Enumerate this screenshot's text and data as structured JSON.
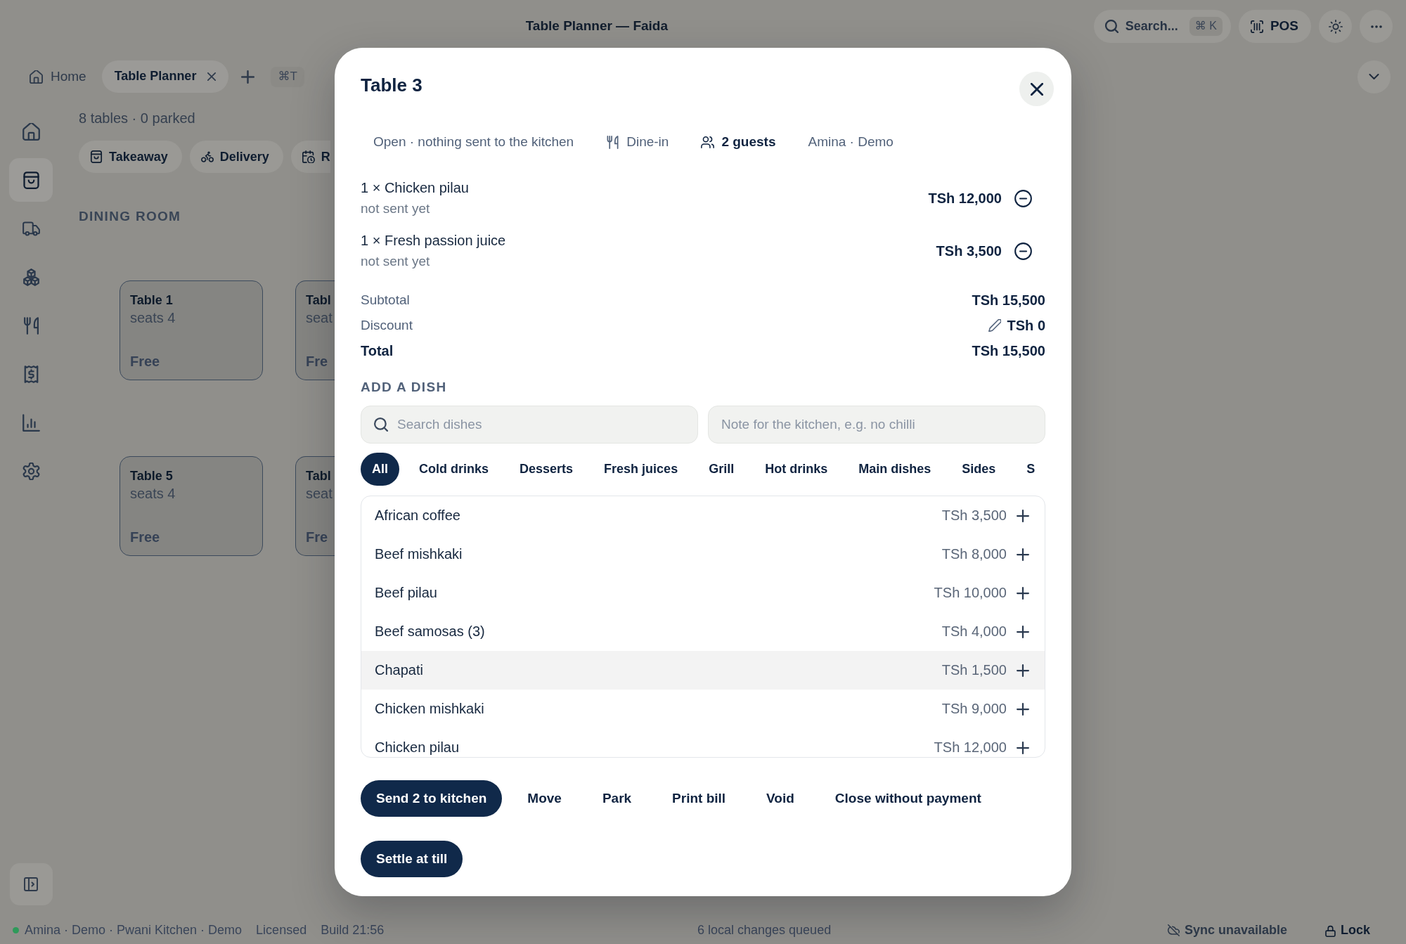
{
  "window": {
    "title": "Table Planner — Faida"
  },
  "toolbar": {
    "search": {
      "label": "Search...",
      "shortcut": "⌘ K"
    },
    "pos": {
      "label": "POS"
    }
  },
  "tabs": [
    {
      "kind": "home",
      "label": "Home",
      "selected": false,
      "closable": false
    },
    {
      "kind": "page",
      "label": "Table Planner",
      "selected": true,
      "closable": true
    }
  ],
  "new_tab": {
    "shortcut": "⌘T"
  },
  "sidebar": {
    "items": [
      {
        "selected": false
      },
      {
        "selected": true
      },
      {
        "selected": false
      },
      {
        "selected": false
      },
      {
        "selected": false
      },
      {
        "selected": false
      },
      {
        "selected": false
      },
      {
        "selected": false
      }
    ]
  },
  "floor": {
    "summary": "8 tables · 0 parked",
    "quick_actions": [
      {
        "label": "Takeaway"
      },
      {
        "label": "Delivery"
      },
      {
        "label": "R"
      }
    ],
    "section": "DINING ROOM",
    "tables": [
      {
        "name": "Table 1",
        "seats": "seats 4",
        "status": "Free"
      },
      {
        "name": "Tabl",
        "seats": "seat",
        "status": "Fre"
      },
      {
        "name": "Table 5",
        "seats": "seats 4",
        "status": "Free"
      },
      {
        "name": "Tabl",
        "seats": "seat",
        "status": "Fre"
      }
    ]
  },
  "modal": {
    "title": "Table 3",
    "meta": [
      {
        "kind": "status",
        "text": "Open · nothing sent to the kitchen"
      },
      {
        "kind": "service",
        "text": "Dine-in"
      },
      {
        "kind": "guests",
        "text": "2 guests"
      },
      {
        "kind": "staff",
        "text": "Amina · Demo"
      }
    ],
    "lines": [
      {
        "name": "1 × Chicken pilau",
        "note": "not sent yet",
        "price": "TSh 12,000"
      },
      {
        "name": "1 × Fresh passion juice",
        "note": "not sent yet",
        "price": "TSh 3,500"
      }
    ],
    "totals": [
      {
        "kind": "subtotal",
        "label": "Subtotal",
        "value": "TSh 15,500"
      },
      {
        "kind": "discount",
        "label": "Discount",
        "value": "TSh 0"
      },
      {
        "kind": "total",
        "label": "Total",
        "value": "TSh 15,500"
      }
    ],
    "add_dish": {
      "heading": "ADD A DISH",
      "search": {
        "placeholder": "Search dishes"
      },
      "note": {
        "placeholder": "Note for the kitchen, e.g. no chilli"
      },
      "categories": [
        {
          "label": "All",
          "selected": true
        },
        {
          "label": "Cold drinks",
          "selected": false
        },
        {
          "label": "Desserts",
          "selected": false
        },
        {
          "label": "Fresh juices",
          "selected": false
        },
        {
          "label": "Grill",
          "selected": false
        },
        {
          "label": "Hot drinks",
          "selected": false
        },
        {
          "label": "Main dishes",
          "selected": false
        },
        {
          "label": "Sides",
          "selected": false
        },
        {
          "label": "S",
          "selected": false
        }
      ],
      "dishes": [
        {
          "name": "African coffee",
          "price": "TSh 3,500",
          "highlighted": false
        },
        {
          "name": "Beef mishkaki",
          "price": "TSh 8,000",
          "highlighted": false
        },
        {
          "name": "Beef pilau",
          "price": "TSh 10,000",
          "highlighted": false
        },
        {
          "name": "Beef samosas (3)",
          "price": "TSh 4,000",
          "highlighted": false
        },
        {
          "name": "Chapati",
          "price": "TSh 1,500",
          "highlighted": true
        },
        {
          "name": "Chicken mishkaki",
          "price": "TSh 9,000",
          "highlighted": false
        },
        {
          "name": "Chicken pilau",
          "price": "TSh 12,000",
          "highlighted": false
        }
      ]
    },
    "actions": [
      {
        "kind": "primary",
        "label": "Send 2 to kitchen"
      },
      {
        "kind": "plain",
        "label": "Move"
      },
      {
        "kind": "plain",
        "label": "Park"
      },
      {
        "kind": "plain",
        "label": "Print bill"
      },
      {
        "kind": "plain",
        "label": "Void"
      },
      {
        "kind": "plain",
        "label": "Close without payment"
      },
      {
        "kind": "primary",
        "label": "Settle at till"
      }
    ]
  },
  "status_bar": {
    "account": "Amina · Demo · Pwani Kitchen · Demo",
    "license": "Licensed",
    "build": "Build 21:56",
    "queue": "6 local changes queued",
    "sync": "Sync unavailable",
    "lock": "Lock"
  }
}
